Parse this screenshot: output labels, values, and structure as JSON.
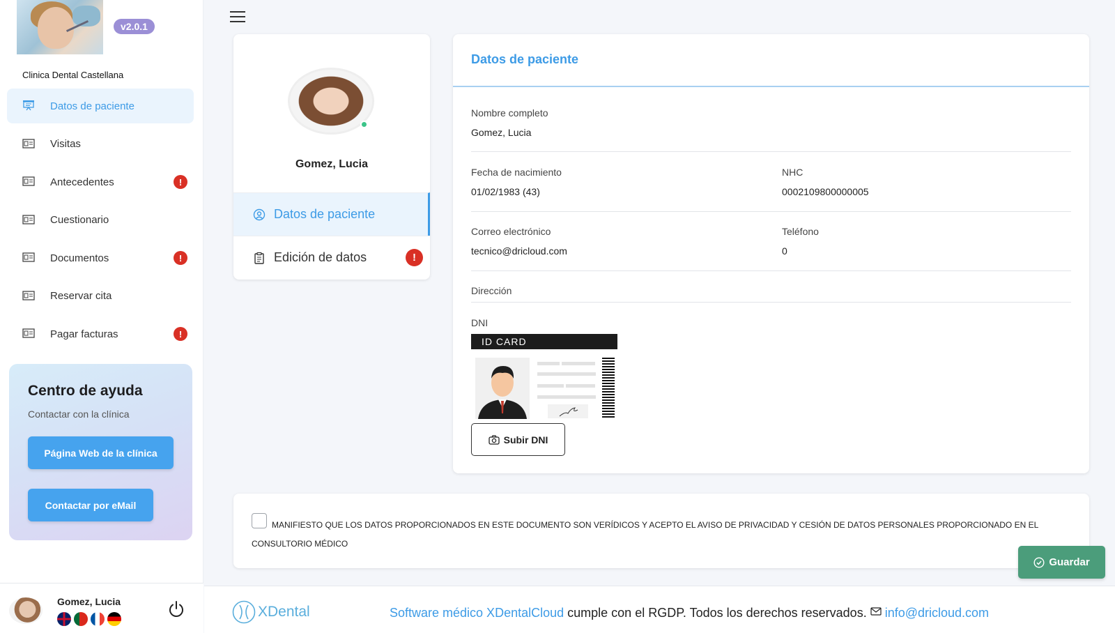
{
  "app": {
    "version": "v2.0.1",
    "clinic_name": "Clinica Dental Castellana"
  },
  "sidebar": {
    "items": [
      {
        "label": "Datos de paciente",
        "active": true,
        "alert": false,
        "icon": "presentation-icon"
      },
      {
        "label": "Visitas",
        "active": false,
        "alert": false,
        "icon": "id-card-icon"
      },
      {
        "label": "Antecedentes",
        "active": false,
        "alert": true,
        "icon": "id-card-icon"
      },
      {
        "label": "Cuestionario",
        "active": false,
        "alert": false,
        "icon": "id-card-icon"
      },
      {
        "label": "Documentos",
        "active": false,
        "alert": true,
        "icon": "id-card-icon"
      },
      {
        "label": "Reservar cita",
        "active": false,
        "alert": false,
        "icon": "id-card-icon"
      },
      {
        "label": "Pagar facturas",
        "active": false,
        "alert": true,
        "icon": "id-card-icon"
      }
    ],
    "badge_symbol": "!"
  },
  "help": {
    "title": "Centro de ayuda",
    "subtitle": "Contactar con la clínica",
    "web_button": "Página Web de la clínica",
    "email_button": "Contactar por eMail"
  },
  "user": {
    "name": "Gomez, Lucia",
    "languages": [
      "uk-flag",
      "pt-flag",
      "fr-flag",
      "de-flag"
    ]
  },
  "profile": {
    "name": "Gomez, Lucia",
    "nav": [
      {
        "label": "Datos de paciente",
        "active": true
      },
      {
        "label": "Edición de datos",
        "active": false,
        "badge": "!"
      }
    ]
  },
  "patient": {
    "title": "Datos de paciente",
    "full_name_label": "Nombre completo",
    "full_name": "Gomez, Lucia",
    "dob_label": "Fecha de nacimiento",
    "dob": "01/02/1983 (43)",
    "nhc_label": "NHC",
    "nhc": "0002109800000005",
    "email_label": "Correo electrónico",
    "email": "tecnico@dricloud.com",
    "phone_label": "Teléfono",
    "phone": "0",
    "address_label": "Dirección",
    "dni_label": "DNI",
    "id_card_header": "ID CARD",
    "upload_button": "Subir DNI"
  },
  "consent": {
    "text": "MANIFIESTO QUE LOS DATOS PROPORCIONADOS EN ESTE DOCUMENTO SON VERÍDICOS Y ACEPTO EL AVISO DE PRIVACIDAD Y CESIÓN DE DATOS PERSONALES PROPORCIONADO EN EL CONSULTORIO MÉDICO",
    "checked": false
  },
  "actions": {
    "save": "Guardar"
  },
  "footer": {
    "brand": "XDental",
    "software_link": "Software médico XDentalCloud",
    "text": " cumple con el RGDP. Todos los derechos reservados. ",
    "email": "info@dricloud.com"
  },
  "colors": {
    "accent": "#3d9be6",
    "alert": "#d93025",
    "save": "#4b9d7b",
    "version_badge": "#9b8fd6"
  }
}
